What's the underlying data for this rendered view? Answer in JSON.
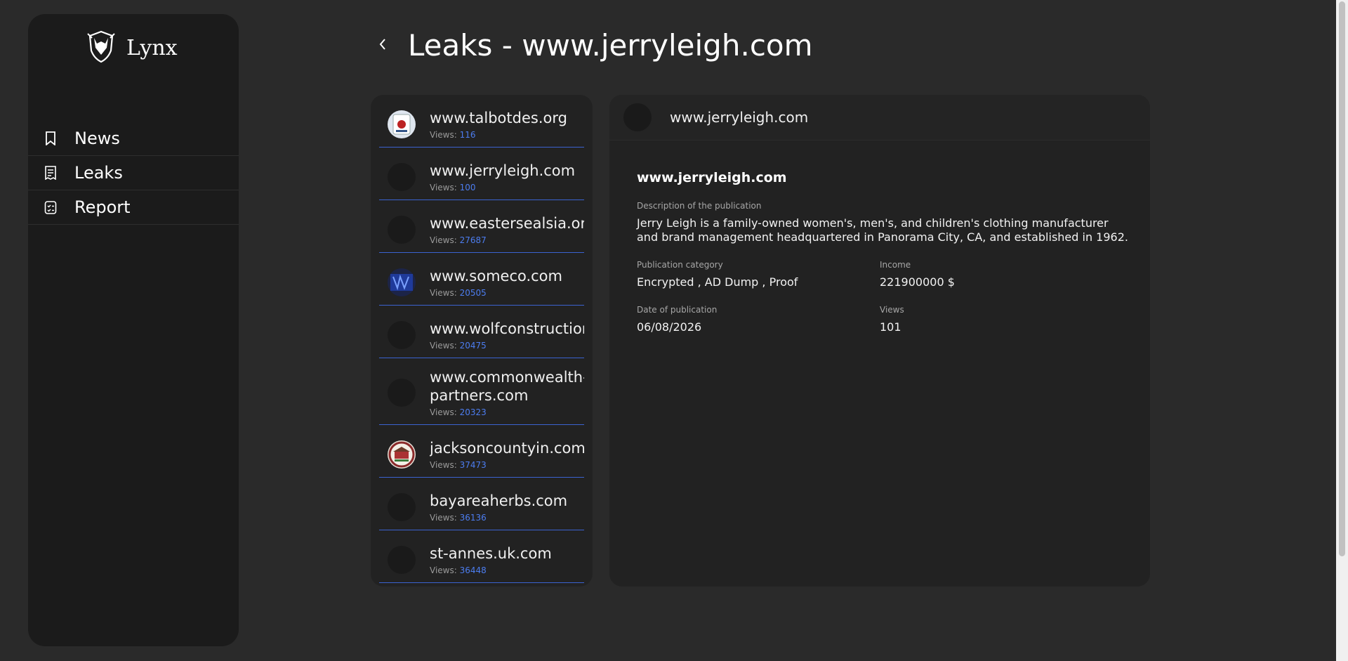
{
  "app": {
    "name": "Lynx"
  },
  "sidebar": {
    "items": [
      {
        "label": "News",
        "icon": "bookmark-icon"
      },
      {
        "label": "Leaks",
        "icon": "receipt-icon"
      },
      {
        "label": "Report",
        "icon": "checklist-icon"
      }
    ]
  },
  "header": {
    "title": "Leaks - www.jerryleigh.com"
  },
  "list": {
    "items": [
      {
        "name": "www.talbotdes.org",
        "views_label": "Views:",
        "views": "116"
      },
      {
        "name": "www.jerryleigh.com",
        "views_label": "Views:",
        "views": "100"
      },
      {
        "name": "www.eastersealsia.org",
        "views_label": "Views:",
        "views": "27687"
      },
      {
        "name": "www.someco.com",
        "views_label": "Views:",
        "views": "20505"
      },
      {
        "name": "www.wolfconstruction.n",
        "views_label": "Views:",
        "views": "20475"
      },
      {
        "name": "www.commonwealth-partners.com",
        "views_label": "Views:",
        "views": "20323"
      },
      {
        "name": "jacksoncountyin.com",
        "views_label": "Views:",
        "views": "37473"
      },
      {
        "name": "bayareaherbs.com",
        "views_label": "Views:",
        "views": "36136"
      },
      {
        "name": "st-annes.uk.com",
        "views_label": "Views:",
        "views": "36448"
      }
    ]
  },
  "detail": {
    "header_title": "www.jerryleigh.com",
    "name": "www.jerryleigh.com",
    "description_label": "Description of the publication",
    "description": "Jerry Leigh is a family-owned women's, men's, and children's clothing manufacturer and brand management headquartered in Panorama City, CA, and established in 1962.",
    "category_label": "Publication category",
    "category": "Encrypted , AD Dump , Proof",
    "income_label": "Income",
    "income": "221900000 $",
    "date_label": "Date of publication",
    "date": "06/08/2026",
    "views_label": "Views",
    "views": "101"
  },
  "colors": {
    "accent": "#4c7df0",
    "divider": "#3b63d1",
    "background": "#2a2a2a",
    "panel": "#222222",
    "sidebar": "#1b1b1b"
  }
}
